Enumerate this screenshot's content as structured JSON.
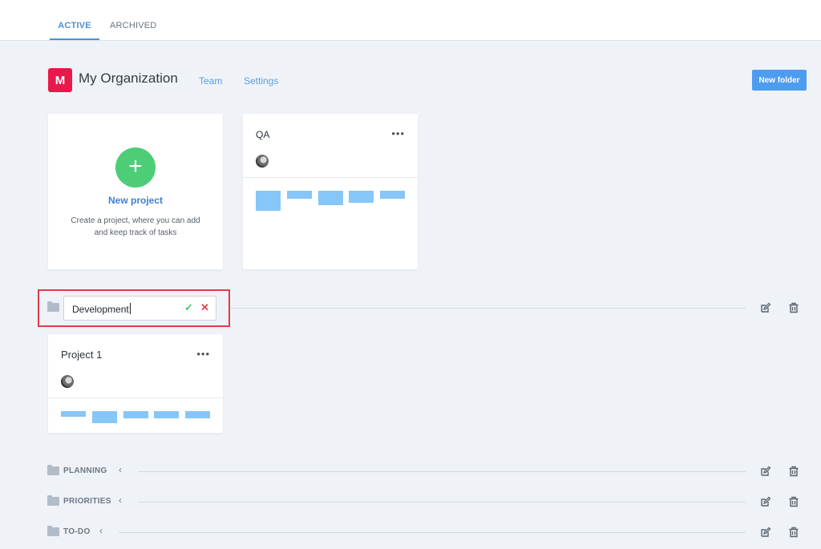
{
  "tabs": [
    {
      "label": "ACTIVE",
      "active": true
    },
    {
      "label": "ARCHIVED",
      "active": false
    }
  ],
  "org": {
    "initial": "M",
    "name": "My Organization",
    "avatar_color": "#e8194a",
    "links": {
      "team": "Team",
      "settings": "Settings"
    }
  },
  "actions": {
    "new_folder": "New folder"
  },
  "new_project_card": {
    "title": "New project",
    "description": "Create a project, where you can add and keep track of tasks",
    "icon": "plus-icon"
  },
  "projects": [
    {
      "title": "QA",
      "menu": "•••",
      "member_avatar": "user-avatar"
    },
    {
      "title": "Project 1",
      "menu": "•••",
      "member_avatar": "user-avatar"
    }
  ],
  "folder_edit": {
    "value": "Development",
    "confirm_icon": "check-icon",
    "cancel_icon": "close-icon"
  },
  "folders": [
    {
      "label": "PLANNING",
      "icon": "folder-icon",
      "toggle": "‹"
    },
    {
      "label": "PRIORITIES",
      "icon": "folder-icon",
      "toggle": "‹"
    },
    {
      "label": "TO-DO",
      "icon": "folder-icon",
      "toggle": "‹"
    }
  ],
  "colors": {
    "accent": "#4a90d9",
    "primary_button": "#4d9cf0",
    "add": "#4ccd76",
    "bar": "#86c6f8",
    "highlight_border": "#e43a4b"
  }
}
